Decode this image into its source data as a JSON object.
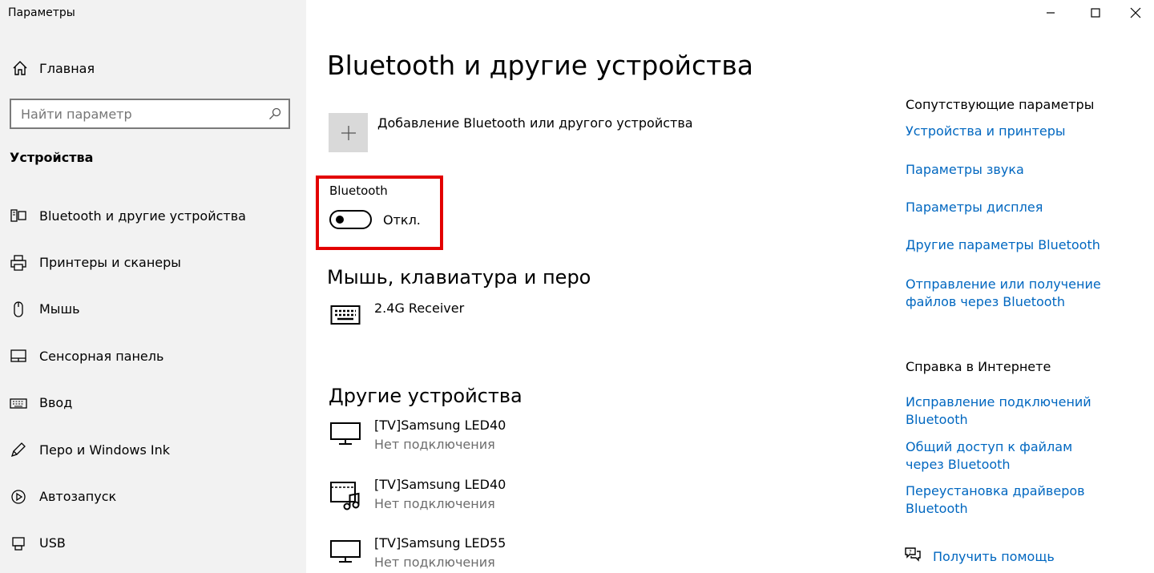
{
  "window": {
    "title": "Параметры"
  },
  "sidebar": {
    "home_label": "Главная",
    "search_placeholder": "Найти параметр",
    "section_title": "Устройства",
    "items": [
      {
        "label": "Bluetooth и другие устройства",
        "icon": "bluetooth-devices-icon"
      },
      {
        "label": "Принтеры и сканеры",
        "icon": "printer-icon"
      },
      {
        "label": "Мышь",
        "icon": "mouse-icon"
      },
      {
        "label": "Сенсорная панель",
        "icon": "touchpad-icon"
      },
      {
        "label": "Ввод",
        "icon": "keyboard-icon"
      },
      {
        "label": "Перо и Windows Ink",
        "icon": "pen-icon"
      },
      {
        "label": "Автозапуск",
        "icon": "autoplay-icon"
      },
      {
        "label": "USB",
        "icon": "usb-icon"
      }
    ]
  },
  "main": {
    "title": "Bluetooth и другие устройства",
    "add_device_label": "Добавление Bluetooth или другого устройства",
    "bluetooth": {
      "label": "Bluetooth",
      "state": "Откл.",
      "enabled": false
    },
    "mouse_section": {
      "title": "Мышь, клавиатура и перо",
      "devices": [
        {
          "name": "2.4G Receiver",
          "icon": "keyboard-icon"
        }
      ]
    },
    "other_section": {
      "title": "Другие устройства",
      "devices": [
        {
          "name": "[TV]Samsung LED40",
          "status": "Нет подключения",
          "icon": "monitor-icon"
        },
        {
          "name": "[TV]Samsung LED40",
          "status": "Нет подключения",
          "icon": "media-device-icon"
        },
        {
          "name": "[TV]Samsung LED55",
          "status": "Нет подключения",
          "icon": "monitor-icon"
        }
      ]
    }
  },
  "related": {
    "title": "Сопутствующие параметры",
    "links": [
      "Устройства и принтеры",
      "Параметры звука",
      "Параметры дисплея",
      "Другие параметры Bluetooth",
      "Отправление или получение файлов через Bluetooth"
    ]
  },
  "web_help": {
    "title": "Справка в Интернете",
    "links": [
      "Исправление подключений Bluetooth",
      "Общий доступ к файлам через Bluetooth",
      "Переустановка драйверов Bluetooth"
    ],
    "get_help": "Получить помощь"
  },
  "colors": {
    "link": "#0067c0",
    "highlight": "#e30000",
    "sidebar_bg": "#f2f2f2"
  }
}
